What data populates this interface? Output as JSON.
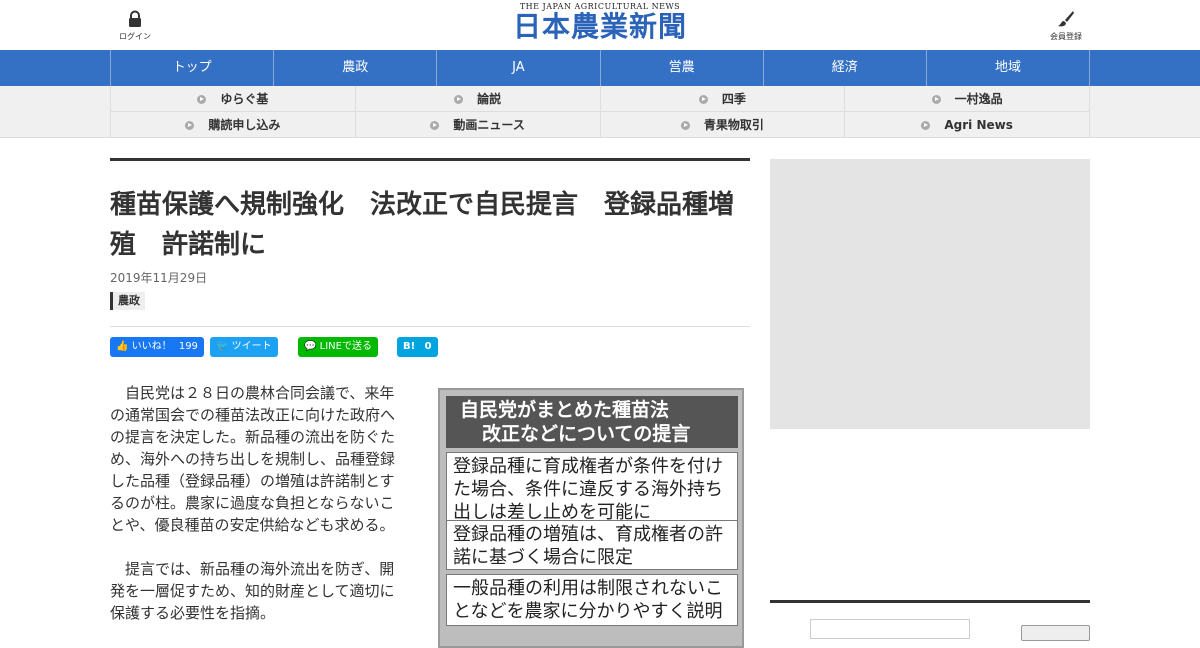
{
  "header": {
    "login_label": "ログイン",
    "member_label": "会員登録",
    "logo_en": "THE JAPAN AGRICULTURAL NEWS",
    "logo_jp": "日本農業新聞"
  },
  "global_nav": {
    "items": [
      "トップ",
      "農政",
      "JA",
      "営農",
      "経済",
      "地域"
    ]
  },
  "sub_nav": {
    "items": [
      "ゆらぐ基",
      "論説",
      "四季",
      "一村逸品",
      "購読申し込み",
      "動画ニュース",
      "青果物取引",
      "Agri News"
    ]
  },
  "article": {
    "title": "種苗保護へ規制強化　法改正で自民提言　登録品種増殖　許諾制に",
    "date": "2019年11月29日",
    "category": "農政",
    "share": {
      "fb_label": "いいね！",
      "fb_count": "199",
      "tw_label": "ツイート",
      "line_label": "LINEで送る",
      "hb_label": "B!",
      "hb_count": "0"
    },
    "paragraphs": [
      "自民党は２８日の農林合同会議で、来年の通常国会での種苗法改正に向けた政府への提言を決定した。新品種の流出を防ぐため、海外への持ち出しを規制し、品種登録した品種（登録品種）の増殖は許諾制とするのが柱。農家に過度な負担とならないことや、優良種苗の安定供給なども求める。",
      "提言では、新品種の海外流出を防ぎ、開発を一層促すため、知的財産として適切に保護する必要性を指摘。"
    ],
    "figure": {
      "heading_line1": "自民党がまとめた種苗法",
      "heading_line2": "改正などについての提言",
      "boxes": [
        "登録品種に育成権者が条件を付けた場合、条件に違反する海外持ち出しは差し止めを可能に",
        "登録品種の増殖は、育成権者の許諾に基づく場合に限定",
        "一般品種の利用は制限されないことなどを農家に分かりやすく説明"
      ]
    }
  },
  "colors": {
    "nav_blue": "#3470c4",
    "logo_blue": "#2a63b7",
    "fb": "#1877f2",
    "twitter": "#1da1f2",
    "line": "#00b900",
    "hatena": "#00a4de"
  }
}
